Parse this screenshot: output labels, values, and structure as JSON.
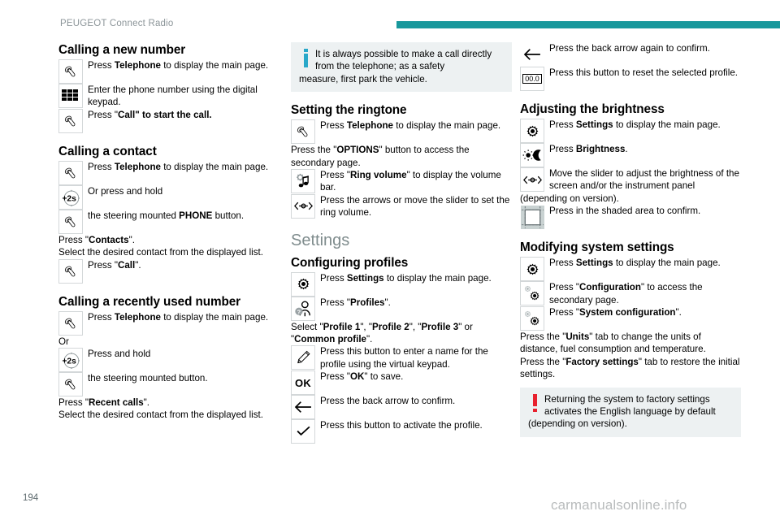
{
  "header": {
    "title": "PEUGEOT Connect Radio",
    "accent_color": "#18989c"
  },
  "footer": {
    "page_number": "194",
    "watermark": "carmanualsonline.info"
  },
  "column1": {
    "heading_new_number": "Calling a new number",
    "step_phone_main": {
      "pre": "Press ",
      "bold": "Telephone",
      "post": " to display the main page."
    },
    "step_keypad": "Enter the phone number using the digital keypad.",
    "step_call": {
      "pre": "Press \"",
      "bold": "Call\" to start the call.",
      "post": ""
    },
    "heading_contact": "Calling a contact",
    "c_step_phone_main": {
      "pre": "Press ",
      "bold": "Telephone",
      "post": " to display the main page."
    },
    "c_step_hold": "Or press and hold",
    "hold_label": "+2s",
    "c_step_steering": {
      "pre": "the steering mounted ",
      "bold": "PHONE",
      "post": " button."
    },
    "c_press_contacts": {
      "pre": "Press \"",
      "bold": "Contacts",
      "post": "\"."
    },
    "c_select_line": "Select the desired contact from the displayed list.",
    "c_press_call": {
      "pre": "Press \"",
      "bold": "Call",
      "post": "\"."
    },
    "heading_recent": "Calling a recently used number",
    "r_step_phone_main": {
      "pre": "Press ",
      "bold": "Telephone",
      "post": " to display the main page."
    },
    "r_or": "Or",
    "r_press_hold": "Press and hold",
    "r_steering": "the steering mounted button.",
    "r_press_recent": {
      "pre": "Press \"",
      "bold": "Recent calls",
      "post": "\"."
    },
    "r_select_line": "Select the desired contact from the displayed list."
  },
  "column2": {
    "info_callout": {
      "lead": "It is always possible to make a call directly from the telephone; as a safety",
      "tail": "measure, first park the vehicle."
    },
    "heading_ringtone": "Setting the ringtone",
    "rt_step_phone": {
      "pre": "Press ",
      "bold": "Telephone",
      "post": " to display the main page."
    },
    "rt_options": {
      "pre": "Press the \"",
      "bold": "OPTIONS",
      "post": "\" button to access the secondary page."
    },
    "rt_ring_volume": {
      "pre": "Press \"",
      "bold": "Ring volume",
      "post": "\" to display the volume bar."
    },
    "rt_slider": "Press the arrows or move the slider to set the ring volume.",
    "heading_settings": "Settings",
    "heading_profiles": "Configuring profiles",
    "p_settings_main": {
      "pre": "Press ",
      "bold": "Settings",
      "post": " to display the main page."
    },
    "p_press_profiles": {
      "pre": "Press \"",
      "bold": "Profiles",
      "post": "\"."
    },
    "p_select_line": {
      "pre": "Select \"",
      "b1": "Profile 1",
      "m1": "\", \"",
      "b2": "Profile 2",
      "m2": "\", \"",
      "b3": "Profile 3",
      "m3": "\" or \"",
      "b4": "Common profile",
      "post": "\"."
    },
    "p_enter_name": "Press this button to enter a name for the profile using the virtual keypad.",
    "p_ok_save": {
      "pre": "Press \"",
      "bold": "OK",
      "post": "\" to save."
    },
    "ok_label": "OK",
    "p_back_arrow": "Press the back arrow to confirm.",
    "p_activate": "Press this button to activate the profile."
  },
  "column3": {
    "back_again": "Press the back arrow again to confirm.",
    "reset_profile": "Press this button to reset the selected profile.",
    "reset_label": "00.0",
    "heading_brightness": "Adjusting the brightness",
    "b_settings_main": {
      "pre": "Press ",
      "bold": "Settings",
      "post": " to display the main page."
    },
    "b_press_brightness": {
      "pre": "Press ",
      "bold": "Brightness",
      "post": "."
    },
    "b_move_slider": "Move the slider to adjust the brightness of the screen and/or the instrument panel",
    "b_move_slider_tail": "(depending on version).",
    "b_shaded_area": "Press in the shaded area to confirm.",
    "heading_system": "Modifying system settings",
    "s_settings_main": {
      "pre": "Press ",
      "bold": "Settings",
      "post": " to display the main page."
    },
    "s_configuration": {
      "pre": "Press \"",
      "bold": "Configuration",
      "post": "\" to access the secondary page."
    },
    "s_system_config": {
      "pre": "Press \"",
      "bold": "System configuration",
      "post": "\"."
    },
    "s_units_tab": {
      "pre": "Press the \"",
      "bold": "Units",
      "post": "\" tab to change the units of distance, fuel consumption and temperature."
    },
    "s_factory_tab": {
      "pre": "Press the \"",
      "bold": "Factory settings",
      "post": "\" tab to restore the initial settings."
    },
    "warn_callout": {
      "lead": "Returning the system to factory settings activates the English language by default",
      "tail": "(depending on version)."
    }
  }
}
